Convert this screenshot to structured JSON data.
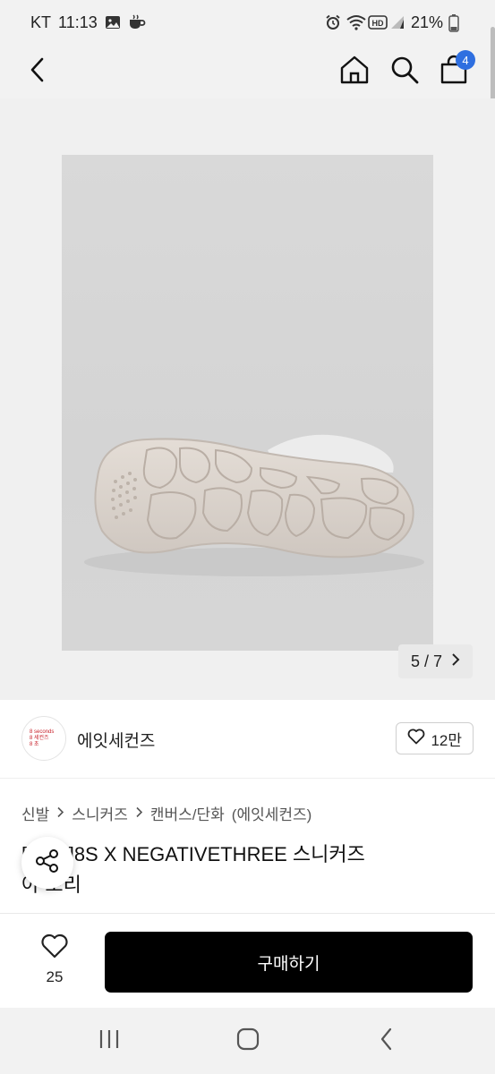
{
  "status_bar": {
    "carrier": "KT",
    "time": "11:13",
    "battery": "21%",
    "icons": [
      "gallery-icon",
      "coffee-icon",
      "alarm-icon",
      "wifi-icon",
      "hd-icon",
      "signal-icon",
      "battery-icon"
    ]
  },
  "header": {
    "cart_count": "4",
    "icons": [
      "back-icon",
      "home-icon",
      "search-icon",
      "cart-icon"
    ]
  },
  "gallery": {
    "pager_text": "5 / 7",
    "current": 5,
    "total": 7
  },
  "brand": {
    "logo_lines": [
      "8 seconds",
      "8 세컨즈",
      "8 초"
    ],
    "name": "에잇세컨즈",
    "likes": "12만"
  },
  "breadcrumb": [
    "신발",
    "스니커즈",
    "캔버스/단화",
    "(에잇세컨즈)"
  ],
  "product": {
    "title_line1": "[  반품]8S X NEGATIVETHREE 스니커즈",
    "title_line2": "아 보리"
  },
  "action_bar": {
    "wish_count": "25",
    "buy_label": "구매하기"
  },
  "colors": {
    "accent": "#2f6fe0",
    "buy_button": "#000000",
    "brand_red": "#c8202a"
  }
}
